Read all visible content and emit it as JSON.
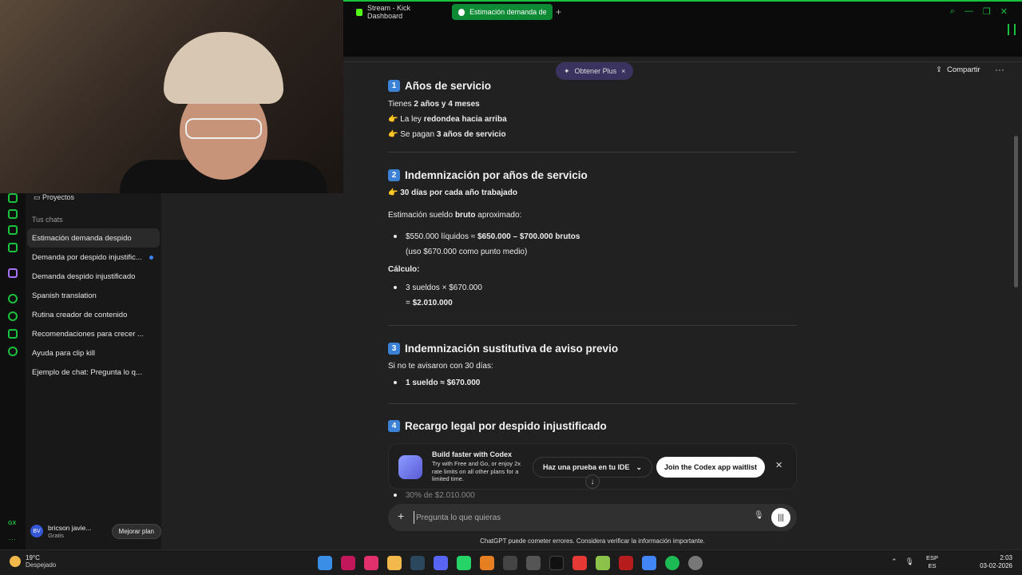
{
  "browser": {
    "tabs": [
      {
        "label": "Stream - Kick Dashboard"
      },
      {
        "label": "Estimación demanda desp"
      }
    ]
  },
  "sidebar": {
    "projects_label": "Proyectos",
    "chats_heading": "Tus chats",
    "items": [
      {
        "label": "Estimación demanda despido"
      },
      {
        "label": "Demanda por despido injustific..."
      },
      {
        "label": "Demanda despido injustificado"
      },
      {
        "label": "Spanish translation"
      },
      {
        "label": "Rutina creador de contenido"
      },
      {
        "label": "Recomendaciones para crecer ..."
      },
      {
        "label": "Ayuda para clip kill"
      },
      {
        "label": "Ejemplo de chat: Pregunta lo q..."
      }
    ],
    "user": {
      "initials": "BV",
      "name": "bricson javie...",
      "plan": "Gratis",
      "upgrade_label": "Mejorar plan"
    },
    "gx_label": "GX"
  },
  "header": {
    "plus_label": "Obtener Plus",
    "share_label": "Compartir"
  },
  "article": {
    "s1": {
      "num": "1",
      "title": "Años de servicio",
      "line1_pre": "Tienes ",
      "line1_bold": "2 años y 4 meses",
      "line2_pre": "La ley ",
      "line2_bold": "redondea hacia arriba",
      "line3_pre": "Se pagan ",
      "line3_bold": "3 años de servicio"
    },
    "s2": {
      "num": "2",
      "title": "Indemnización por años de servicio",
      "bullet_bold": "30 días por cada año trabajado",
      "est_pre": "Estimación sueldo ",
      "est_bold": "bruto",
      "est_post": " aproximado:",
      "li1_pre": "$550.000 líquidos ≈ ",
      "li1_bold": "$650.000 – $700.000 brutos",
      "li1_sub": "(uso $670.000 como punto medio)",
      "calc_label": "Cálculo:",
      "li2_line1": "3 sueldos × $670.000",
      "li2_eq": "= ",
      "li2_bold": "$2.010.000"
    },
    "s3": {
      "num": "3",
      "title": "Indemnización sustitutiva de aviso previo",
      "line1": "Si no te avisaron con 30 días:",
      "li_bold": "1 sueldo ≈ $670.000"
    },
    "s4": {
      "num": "4",
      "title": "Recargo legal por despido injustificado",
      "partial": "30% de $2.010.000"
    }
  },
  "codex": {
    "title": "Build faster with Codex",
    "subtitle": "Try with Free and Go, or enjoy 2x rate limits on all other plans for a limited time.",
    "ide_label": "Haz una prueba en tu IDE",
    "waitlist_label": "Join the Codex app waitlist"
  },
  "composer": {
    "placeholder": "Pregunta lo que quieras"
  },
  "disclaimer": "ChatGPT puede cometer errores. Considera verificar la información importante.",
  "taskbar": {
    "temp": "19°C",
    "weather": "Despejado",
    "lang1": "ESP",
    "lang2": "ES",
    "time": "2:03",
    "date": "03-02-2026"
  },
  "colors": {
    "accent": "#19c23d",
    "brand_blue": "#3b82d6"
  }
}
